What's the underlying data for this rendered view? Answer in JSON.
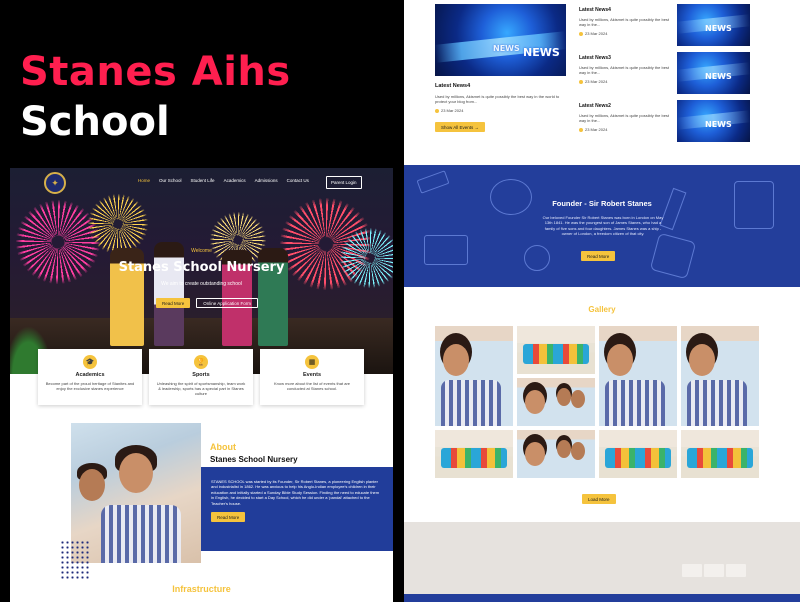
{
  "headline": {
    "line1": "Stanes Aihs",
    "line2": "School"
  },
  "colors": {
    "accent_red": "#ff1f4f",
    "accent_yellow": "#f5c33d",
    "brand_blue": "#233e9b"
  },
  "left_page": {
    "nav": {
      "items": [
        "Home",
        "Our School",
        "Student Life",
        "Academics",
        "Admissions",
        "Contact Us"
      ],
      "parent_login": "Parent Login"
    },
    "hero": {
      "welcome": "Welcome",
      "title": "Stanes School Nursery",
      "subtitle": "We aim to create outstanding school",
      "btn_read": "Read More",
      "btn_apply": "Online Application Form"
    },
    "cards": [
      {
        "title": "Academics",
        "icon": "mortarboard-icon",
        "text": "Become part of the proud heritage of Stanites and enjoy the exclusive stanes experience"
      },
      {
        "title": "Sports",
        "icon": "trophy-icon",
        "text": "Unleashing the spirit of sportsmanship, team work & leadership, sports has a special part in Stanes culture"
      },
      {
        "title": "Events",
        "icon": "calendar-icon",
        "text": "Know more about the list of events that are conducted at Stanes school."
      }
    ],
    "about": {
      "title": "About",
      "subtitle": "Stanes School Nursery",
      "text": "STANES SCHOOL was started by its Founder, Sir Robert Stanes, a pioneering English planter and industrialist in 1862. He was anxious to help his Anglo-Indian employee's children in their education and initially started a Sunday Bible Study Session. Finding the need to educate them in English, he decided to start a Day School, which he did under a 'pandal' attached to the Teacher's house.",
      "btn": "Read More"
    },
    "infrastructure_title": "Infrastructure"
  },
  "right_page": {
    "news_main": {
      "title": "Latest News4",
      "text": "Used by millions, Akismet is quite possibly the best way in the world to protect your blog from...",
      "date": "23 Mar 2024",
      "btn": "Show All Events →"
    },
    "news_list": [
      {
        "title": "Latest News4",
        "text": "Used by millions, Akismet is quite possibly the best way in the...",
        "date": "23 Mar 2024"
      },
      {
        "title": "Latest News3",
        "text": "Used by millions, Akismet is quite possibly the best way in the...",
        "date": "23 Mar 2024"
      },
      {
        "title": "Latest News2",
        "text": "Used by millions, Akismet is quite possibly the best way in the...",
        "date": "23 Mar 2024"
      }
    ],
    "news_word": "NEWS",
    "founder": {
      "title": "Founder - Sir Robert Stanes",
      "text": "Our beloved Founder Sir Robert Stanes was born in London on May 13th 1841. He was the youngest son of James Stanes, who had a family of five sons and four daughters. James Stanes was a ship - owner of London, a freedom citizen of that city.",
      "btn": "Read More"
    },
    "gallery": {
      "title": "Gallery",
      "btn": "Load More"
    }
  }
}
